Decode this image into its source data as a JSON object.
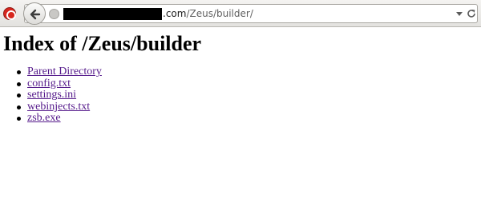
{
  "browser": {
    "url_domain_suffix": ".com",
    "url_path": "/Zeus/builder/"
  },
  "page": {
    "heading": "Index of /Zeus/builder",
    "entries": [
      {
        "label": "Parent Directory"
      },
      {
        "label": "config.txt"
      },
      {
        "label": "settings.ini"
      },
      {
        "label": "webinjects.txt"
      },
      {
        "label": "zsb.exe"
      }
    ]
  },
  "colors": {
    "visited_link": "#551a8b",
    "app_icon": "#d7261e"
  }
}
